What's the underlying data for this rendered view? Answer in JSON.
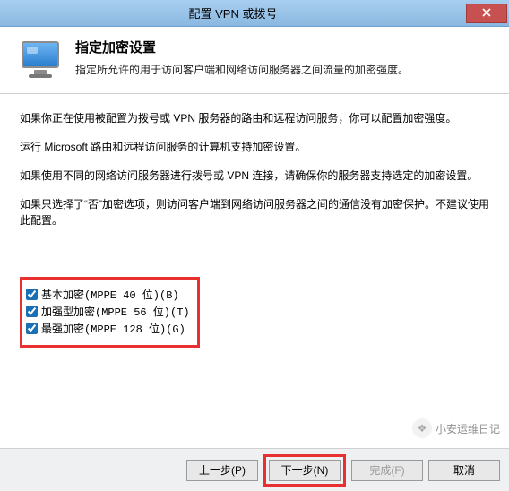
{
  "window": {
    "title": "配置 VPN 或拨号"
  },
  "header": {
    "title": "指定加密设置",
    "subtitle": "指定所允许的用于访问客户端和网络访问服务器之间流量的加密强度。"
  },
  "body": {
    "p1": "如果你正在使用被配置为拨号或 VPN 服务器的路由和远程访问服务，你可以配置加密强度。",
    "p2": "运行 Microsoft 路由和远程访问服务的计算机支持加密设置。",
    "p3": "如果使用不同的网络访问服务器进行拨号或 VPN 连接，请确保你的服务器支持选定的加密设置。",
    "p4": "如果只选择了“否”加密选项，则访问客户端到网络访问服务器之间的通信没有加密保护。不建议使用此配置。"
  },
  "options": {
    "basic": "基本加密(MPPE 40 位)(B)",
    "strong": "加强型加密(MPPE 56 位)(T)",
    "strongest": "最强加密(MPPE 128 位)(G)"
  },
  "footer": {
    "prev": "上一步(P)",
    "next": "下一步(N)",
    "finish": "完成(F)",
    "cancel": "取消"
  },
  "watermark": {
    "text": "小安运维日记"
  }
}
